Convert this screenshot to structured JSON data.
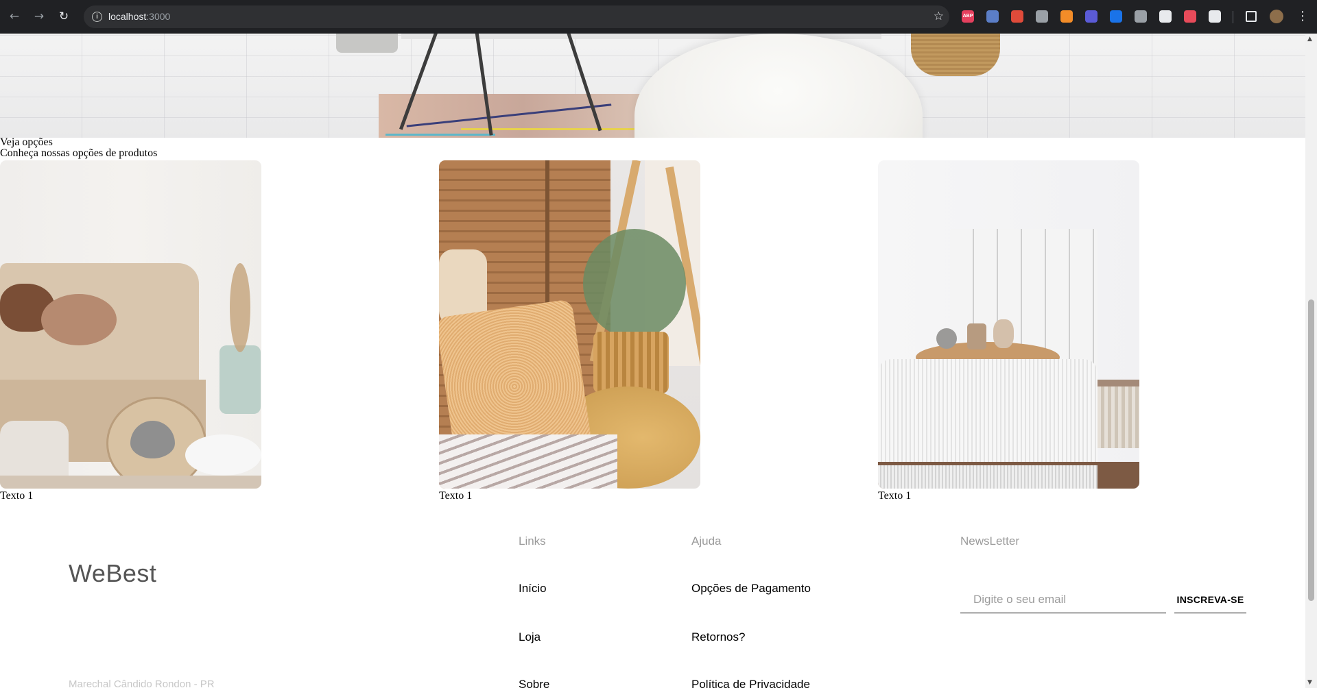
{
  "browser": {
    "url_host": "localhost",
    "url_port": ":3000",
    "extensions": [
      {
        "name": "adblock-plus-icon",
        "label": "ABP",
        "color": "#e5405e"
      },
      {
        "name": "extension-blue-icon",
        "label": "",
        "color": "#5b7ec7"
      },
      {
        "name": "extension-red-icon",
        "label": "",
        "color": "#e04b3a"
      },
      {
        "name": "vue-devtools-icon",
        "label": "",
        "color": "#9aa0a6"
      },
      {
        "name": "extension-orange-icon",
        "label": "",
        "color": "#f28c28"
      },
      {
        "name": "eye-extension-icon",
        "label": "",
        "color": "#5b5bd6"
      },
      {
        "name": "check-extension-icon",
        "label": "",
        "color": "#1a73e8"
      },
      {
        "name": "tab-extension-icon",
        "label": "",
        "color": "#9aa0a6"
      },
      {
        "name": "eyedropper-icon",
        "label": "",
        "color": "#e8eaed"
      },
      {
        "name": "shield-extension-icon",
        "label": "",
        "color": "#e84b5a"
      },
      {
        "name": "extensions-puzzle-icon",
        "label": "",
        "color": "#e8eaed"
      }
    ]
  },
  "section": {
    "title": "Veja opções",
    "subtitle": "Conheça nossas opções de produtos"
  },
  "products": [
    {
      "text": "Texto 1"
    },
    {
      "text": "Texto 1"
    },
    {
      "text": "Texto 1"
    }
  ],
  "footer": {
    "logo": "WeBest",
    "address": "Marechal Cândido Rondon - PR",
    "links_heading": "Links",
    "links": [
      "Início",
      "Loja",
      "Sobre"
    ],
    "help_heading": "Ajuda",
    "help": [
      "Opções de Pagamento",
      "Retornos?",
      "Política de Privacidade"
    ],
    "newsletter_heading": "NewsLetter",
    "newsletter_placeholder": "Digite o seu email",
    "subscribe_label": "INSCREVA-SE"
  }
}
